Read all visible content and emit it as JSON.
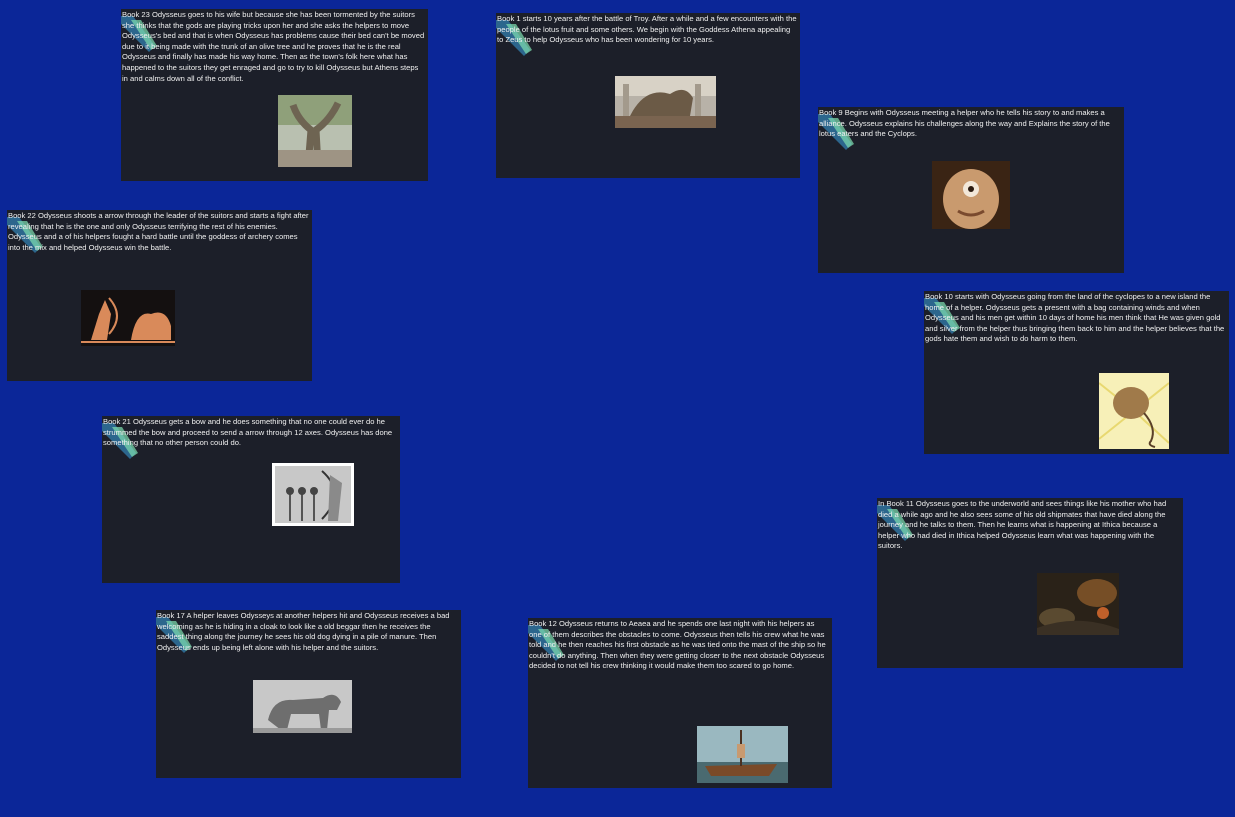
{
  "cards": [
    {
      "id": "book23",
      "text": "Book 23 Odysseus goes to his wife but because she has been tormented by the suitors she thinks that the gods are playing tricks upon her and she asks the helpers to move Odysseus's bed and that is when Odysseus has problems cause their bed can't be moved due to it being made with the trunk of an olive tree and he proves that he is the real Odysseus and finally has made his way home. Then as the town's folk here what has happened to the suitors they get enraged and go to try to kill Odysseus but Athens steps in and calms down all of the conflict.",
      "image": "olive-tree-bed"
    },
    {
      "id": "book1",
      "text": "Book 1 starts 10 years after the battle of Troy. After a while and a few encounters with the people of the lotus fruit and some others.  We begin with the Goddess Athena appealing to Zeus to help Odysseus who has been wondering for 10 years.",
      "image": "trojan-horse"
    },
    {
      "id": "book9",
      "text": "Book 9 Begins with Odysseus meeting a helper who he tells his story to and makes a alliance. Odysseus explains his challenges along the way and Explains the story of the lotus eaters and the Cyclops.",
      "image": "cyclops-face"
    },
    {
      "id": "book22",
      "text": "Book 22 Odysseus shoots a arrow through the leader of the suitors and starts a fight after revealing that he is the one and only Odysseus terrifying the rest of his enemies. Odysseus and a of his helpers fought a hard battle until the goddess of archery comes into the mix and helped Odysseus win the battle.",
      "image": "archer-vase"
    },
    {
      "id": "book10",
      "text": "Book 10 starts with Odysseus going from the land of the cyclopes to a new island the home of a helper. Odysseus gets a present with a bag containing winds and when Odysseus and his men get within 10 days of home his men think that He was given gold and silver from the helper thus bringing them back to him and the helper believes that the gods hate them and wish to do harm to them.",
      "image": "bag-of-winds"
    },
    {
      "id": "book21",
      "text": "Book 21 Odysseus gets a bow and he does something that no one could ever do he strummed the bow and proceed to send a arrow through 12 axes. Odysseus has done something that no other person could do.",
      "image": "bow-and-axes"
    },
    {
      "id": "book11",
      "text": "In Book 11 Odysseus goes to the underworld and sees things like his mother who had died a while ago and he also sees some of his old shipmates that have died along the journey and he talks to them. Then he learns what is happening at Ithica because a helper who had died in Ithica helped Odysseus learn what was happening with the suitors.",
      "image": "underworld"
    },
    {
      "id": "book17",
      "text": "Book 17 A helper leaves Odysseys at another helpers hit and Odysseus receives a bad welcoming as he is hiding in a cloak to look like a old beggar then he receives the saddest thing along the journey he sees his old dog dying in a pile of manure. Then Odysseus ends up being left alone with his helper and the suitors.",
      "image": "old-dog"
    },
    {
      "id": "book12",
      "text": "Book 12 Odysseus returns to Aeaea and he spends one last night with his helpers as one of them describes the obstacles to come. Odysseus then tells his crew what he was told and he then reaches his first obstacle as he was tied onto the mast of the ship so he couldn't do anything. Then when they were getting closer to the next obstacle Odysseus decided to not tell his crew thinking it would make them too scared to go home.",
      "image": "ship-at-sea"
    }
  ]
}
